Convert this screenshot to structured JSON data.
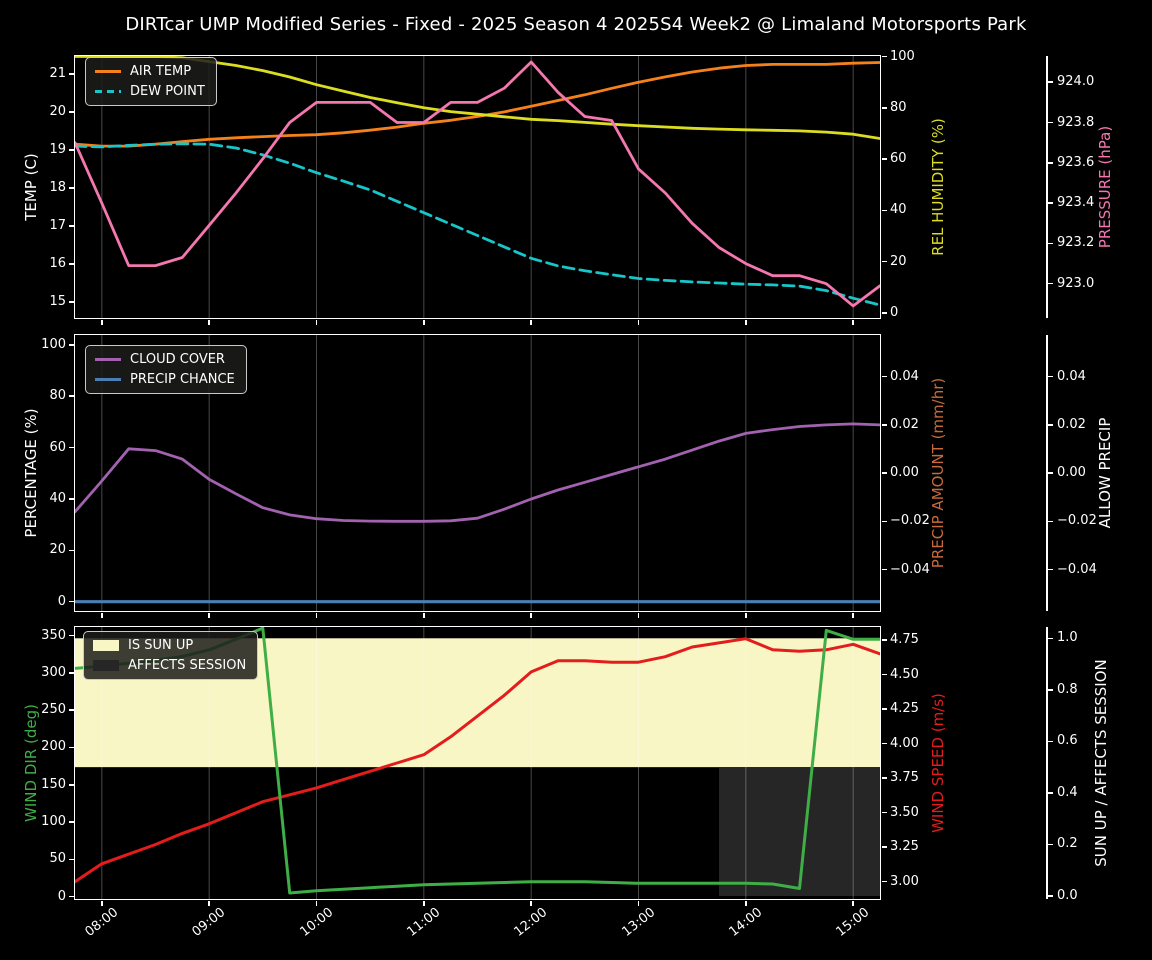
{
  "title": "DIRTcar UMP Modified Series - Fixed - 2025 Season 4 2025S4 Week2 @ Limaland Motorsports Park",
  "colors": {
    "background": "#000000",
    "text": "#ffffff",
    "spine": "#ffffff",
    "grid": "rgba(255,255,255,0.28)",
    "air_temp": "#f5811b",
    "dew_point": "#18c5c9",
    "rel_humidity": "#dcdc21",
    "pressure": "#f577b0",
    "cloud_cover": "#a262b0",
    "precip_chance": "#4a7fb5",
    "precip_amount": "#c66a3d",
    "wind_dir": "#3fae46",
    "wind_speed": "#e31c1c",
    "sun_up_fill": "#f9f6c6",
    "affects_session_fill": "#262626"
  },
  "x_tick_labels": [
    "08:00",
    "09:00",
    "10:00",
    "11:00",
    "12:00",
    "13:00",
    "14:00",
    "15:00"
  ],
  "chart_data": [
    {
      "type": "line",
      "name": "temperature-humidity-pressure-panel",
      "x": [
        "07:45",
        "08:00",
        "08:15",
        "08:30",
        "08:45",
        "09:00",
        "09:15",
        "09:30",
        "09:45",
        "10:00",
        "10:15",
        "10:30",
        "10:45",
        "11:00",
        "11:15",
        "11:30",
        "11:45",
        "12:00",
        "12:15",
        "12:30",
        "12:45",
        "13:00",
        "13:15",
        "13:30",
        "13:45",
        "14:00",
        "14:15",
        "14:30",
        "14:45",
        "15:00",
        "15:15"
      ],
      "axes": {
        "left": {
          "label": "TEMP (C)",
          "color": "#ffffff",
          "min": 14.58,
          "max": 21.47,
          "tick_values": [
            15,
            16,
            17,
            18,
            19,
            20,
            21
          ],
          "tick_labels": [
            "15",
            "16",
            "17",
            "18",
            "19",
            "20",
            "21"
          ]
        },
        "right1": {
          "label": "REL HUMIDITY (%)",
          "color": "#dcdc21",
          "min": -2.0,
          "max": 100.2,
          "tick_values": [
            0,
            20,
            40,
            60,
            80,
            100
          ],
          "tick_labels": [
            "0",
            "20",
            "40",
            "60",
            "80",
            "100"
          ]
        },
        "right2": {
          "label": "PRESSURE (hPa)",
          "color": "#f577b0",
          "min": 922.83,
          "max": 924.13,
          "tick_values": [
            923.0,
            923.2,
            923.4,
            923.6,
            923.8,
            924.0
          ],
          "tick_labels": [
            "923.0",
            "923.2",
            "923.4",
            "923.6",
            "923.8",
            "924.0"
          ]
        }
      },
      "series": [
        {
          "name": "AIR TEMP",
          "key": "air-temp",
          "axis": "left",
          "color": "#f5811b",
          "width": 2.8,
          "values": [
            19.15,
            19.1,
            19.1,
            19.15,
            19.22,
            19.28,
            19.32,
            19.35,
            19.38,
            19.4,
            19.45,
            19.52,
            19.6,
            19.7,
            19.78,
            19.88,
            20.0,
            20.15,
            20.3,
            20.45,
            20.62,
            20.78,
            20.92,
            21.05,
            21.15,
            21.22,
            21.25,
            21.25,
            21.25,
            21.28,
            21.3
          ]
        },
        {
          "name": "DEW POINT",
          "key": "dew-point",
          "axis": "left",
          "color": "#18c5c9",
          "width": 2.8,
          "dashed": true,
          "values": [
            19.1,
            19.08,
            19.12,
            19.15,
            19.16,
            19.15,
            19.05,
            18.87,
            18.65,
            18.4,
            18.18,
            17.95,
            17.65,
            17.35,
            17.05,
            16.75,
            16.45,
            16.15,
            15.95,
            15.82,
            15.72,
            15.62,
            15.57,
            15.53,
            15.5,
            15.47,
            15.45,
            15.42,
            15.3,
            15.1,
            14.92
          ]
        },
        {
          "name": "REL HUMIDITY",
          "key": "rel-humidity",
          "axis": "right1",
          "color": "#dcdc21",
          "width": 2.8,
          "values": [
            100,
            100,
            100,
            100,
            99.5,
            98,
            96.5,
            94.5,
            92,
            89,
            86.5,
            84,
            82,
            80,
            78.5,
            77.5,
            76.5,
            75.5,
            75,
            74.3,
            73.6,
            73,
            72.5,
            72,
            71.7,
            71.4,
            71.2,
            71,
            70.5,
            69.7,
            68
          ]
        },
        {
          "name": "PRESSURE",
          "key": "pressure",
          "axis": "right2",
          "color": "#f577b0",
          "width": 2.8,
          "values": [
            923.7,
            923.4,
            923.09,
            923.09,
            923.13,
            923.29,
            923.45,
            923.62,
            923.8,
            923.9,
            923.9,
            923.9,
            923.8,
            923.8,
            923.9,
            923.9,
            923.97,
            924.1,
            923.95,
            923.83,
            923.81,
            923.57,
            923.45,
            923.3,
            923.18,
            923.1,
            923.04,
            923.04,
            923.0,
            922.89,
            922.99
          ]
        }
      ],
      "legend": [
        {
          "label": "AIR TEMP",
          "chip": "line",
          "color": "#f5811b"
        },
        {
          "label": "DEW POINT",
          "chip": "dashed",
          "color": "#18c5c9"
        }
      ]
    },
    {
      "type": "line",
      "name": "cloud-precip-panel",
      "x": [
        "07:45",
        "08:00",
        "08:15",
        "08:30",
        "08:45",
        "09:00",
        "09:15",
        "09:30",
        "09:45",
        "10:00",
        "10:15",
        "10:30",
        "10:45",
        "11:00",
        "11:15",
        "11:30",
        "11:45",
        "12:00",
        "12:15",
        "12:30",
        "12:45",
        "13:00",
        "13:15",
        "13:30",
        "13:45",
        "14:00",
        "14:15",
        "14:30",
        "14:45",
        "15:00",
        "15:15"
      ],
      "axes": {
        "left": {
          "label": "PERCENTAGE (%)",
          "color": "#ffffff",
          "min": -3.6,
          "max": 103.8,
          "tick_values": [
            0,
            20,
            40,
            60,
            80,
            100
          ],
          "tick_labels": [
            "0",
            "20",
            "40",
            "60",
            "80",
            "100"
          ]
        },
        "right1": {
          "label": "PRECIP AMOUNT (mm/hr)",
          "color": "#c66a3d",
          "min": -0.0572,
          "max": 0.0573,
          "tick_values": [
            -0.04,
            -0.02,
            0,
            0.02,
            0.04
          ],
          "tick_labels": [
            "−0.04",
            "−0.02",
            "0.00",
            "0.02",
            "0.04"
          ]
        },
        "right2": {
          "label": "ALLOW PRECIP",
          "color": "#ffffff",
          "min": -0.0572,
          "max": 0.0573,
          "tick_values": [
            -0.04,
            -0.02,
            0,
            0.02,
            0.04
          ],
          "tick_labels": [
            "−0.04",
            "−0.02",
            "0.00",
            "0.02",
            "0.04"
          ]
        }
      },
      "series": [
        {
          "name": "CLOUD COVER",
          "key": "cloud-cover",
          "axis": "left",
          "color": "#a262b0",
          "width": 2.8,
          "values": [
            35,
            47,
            59.5,
            58.8,
            55.5,
            47.6,
            42,
            36.6,
            33.8,
            32.3,
            31.6,
            31.4,
            31.3,
            31.3,
            31.5,
            32.5,
            36,
            40,
            43.5,
            46.5,
            49.5,
            52.5,
            55.5,
            59,
            62.5,
            65.5,
            67,
            68.2,
            68.8,
            69.2,
            68.8
          ]
        },
        {
          "name": "PRECIP CHANCE",
          "key": "precip-chance",
          "axis": "left",
          "color": "#4a7fb5",
          "width": 3.2,
          "values": [
            0,
            0,
            0,
            0,
            0,
            0,
            0,
            0,
            0,
            0,
            0,
            0,
            0,
            0,
            0,
            0,
            0,
            0,
            0,
            0,
            0,
            0,
            0,
            0,
            0,
            0,
            0,
            0,
            0,
            0,
            0
          ]
        }
      ],
      "legend": [
        {
          "label": "CLOUD COVER",
          "chip": "line",
          "color": "#a262b0"
        },
        {
          "label": "PRECIP CHANCE",
          "chip": "line",
          "color": "#4a7fb5"
        }
      ]
    },
    {
      "type": "line",
      "name": "wind-sun-panel",
      "x": [
        "07:45",
        "08:00",
        "08:15",
        "08:30",
        "08:45",
        "09:00",
        "09:15",
        "09:30",
        "09:45",
        "10:00",
        "10:15",
        "10:30",
        "10:45",
        "11:00",
        "11:15",
        "11:30",
        "11:45",
        "12:00",
        "12:15",
        "12:30",
        "12:45",
        "13:00",
        "13:15",
        "13:30",
        "13:45",
        "14:00",
        "14:15",
        "14:30",
        "14:45",
        "15:00",
        "15:15"
      ],
      "axes": {
        "left": {
          "label": "WIND DIR (deg)",
          "color": "#3fae46",
          "min": -3.1,
          "max": 361.5,
          "tick_values": [
            0,
            50,
            100,
            150,
            200,
            250,
            300,
            350
          ],
          "tick_labels": [
            "0",
            "50",
            "100",
            "150",
            "200",
            "250",
            "300",
            "350"
          ]
        },
        "right1": {
          "label": "WIND SPEED (m/s)",
          "color": "#e31c1c",
          "min": 2.875,
          "max": 4.845,
          "tick_values": [
            3.0,
            3.25,
            3.5,
            3.75,
            4.0,
            4.25,
            4.5,
            4.75
          ],
          "tick_labels": [
            "3.00",
            "3.25",
            "3.50",
            "3.75",
            "4.00",
            "4.25",
            "4.50",
            "4.75"
          ]
        },
        "right2": {
          "label": "SUN UP / AFFECTS SESSION",
          "color": "#ffffff",
          "min": -0.0116,
          "max": 1.0438,
          "tick_values": [
            0,
            0.2,
            0.4,
            0.6,
            0.8,
            1.0
          ],
          "tick_labels": [
            "0.0",
            "0.2",
            "0.4",
            "0.6",
            "0.8",
            "1.0"
          ]
        }
      },
      "bands": [
        {
          "name": "is-sun-up-band",
          "label": "IS SUN UP",
          "axis": "right2",
          "from": 0.5,
          "to": 1.0,
          "x_from": "07:45",
          "x_to": "15:15",
          "color": "#f9f6c6"
        },
        {
          "name": "affects-session-band",
          "label": "AFFECTS SESSION",
          "axis": "right2",
          "from": 0.0,
          "to": 0.5,
          "x_from": "13:45",
          "x_to": "15:15",
          "color": "#262626"
        }
      ],
      "series": [
        {
          "name": "WIND SPEED",
          "key": "wind-speed",
          "axis": "right1",
          "color": "#e31c1c",
          "width": 3,
          "values": [
            3.0,
            3.13,
            3.2,
            3.27,
            3.35,
            3.42,
            3.5,
            3.58,
            3.63,
            3.68,
            3.74,
            3.8,
            3.86,
            3.92,
            4.05,
            4.2,
            4.35,
            4.52,
            4.6,
            4.6,
            4.59,
            4.59,
            4.63,
            4.7,
            4.73,
            4.76,
            4.68,
            4.67,
            4.68,
            4.72,
            4.65
          ]
        },
        {
          "name": "WIND DIR",
          "key": "wind-dir",
          "axis": "left",
          "color": "#3fae46",
          "width": 3,
          "values": [
            306,
            309,
            313,
            317,
            322,
            331,
            345,
            360,
            5,
            8,
            10,
            12,
            14,
            16,
            17,
            18,
            19,
            20,
            20,
            20,
            19,
            18,
            18,
            18,
            18,
            18,
            17,
            11,
            357,
            345,
            345
          ]
        }
      ],
      "legend": [
        {
          "label": "IS SUN UP",
          "chip": "patch",
          "color": "#f9f6c6"
        },
        {
          "label": "AFFECTS SESSION",
          "chip": "patch",
          "color": "#262626"
        }
      ]
    }
  ]
}
